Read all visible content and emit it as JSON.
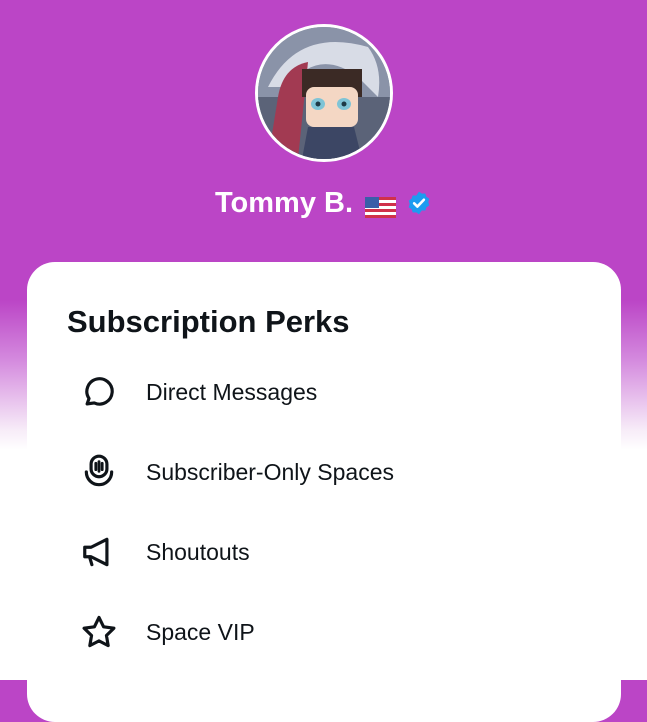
{
  "profile": {
    "name": "Tommy B.",
    "flag_icon": "us-flag-emoji",
    "verified_icon": "verified-badge-icon",
    "avatar_icon": "anime-character-avatar"
  },
  "colors": {
    "header_bg": "#bb45c6",
    "verified_blue": "#1d9bf0",
    "text": "#0f1419"
  },
  "perks": {
    "title": "Subscription Perks",
    "items": [
      {
        "label": "Direct Messages",
        "icon": "message-bubble-icon"
      },
      {
        "label": "Subscriber-Only Spaces",
        "icon": "spaces-microphone-icon"
      },
      {
        "label": "Shoutouts",
        "icon": "megaphone-icon"
      },
      {
        "label": "Space VIP",
        "icon": "star-icon"
      }
    ]
  }
}
